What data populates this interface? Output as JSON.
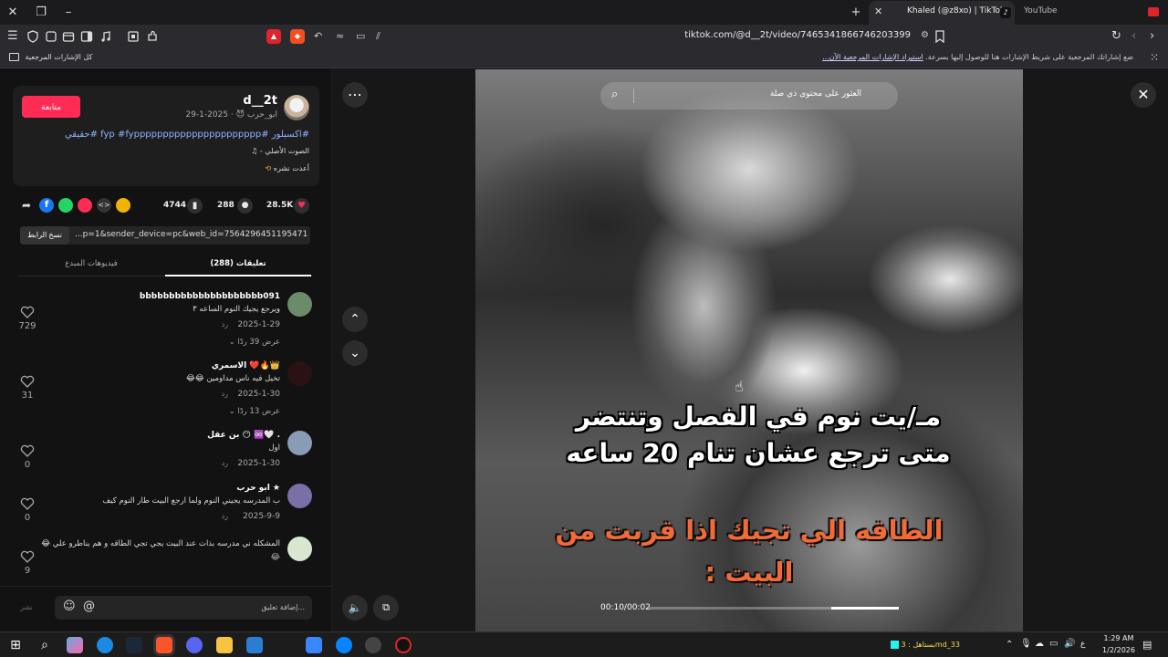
{
  "browser": {
    "active_tab_title": "Khaled (@z8xo) | TikTok",
    "other_tab_title": "YouTube",
    "url": "tiktok.com/@d__2t/video/7465341866746203399",
    "bookmarks_folder": "كل الإشارات المرجعية",
    "bookmarks_hint": "ضع إشاراتك المرجعية على شريط الإشارات هنا للوصول إليها بسرعة.",
    "bookmarks_import": "استيراد الإشارات المرجعية الآن..."
  },
  "post": {
    "follow_label": "متابعة",
    "author_name": "d__2t",
    "author_sub": "ابو_حرب 😈 · 2025-1-29",
    "caption": "#اكسبلور #fyp #fypppppppppppppppppppppp #حقيقي",
    "music": "الصوت الأصلي -",
    "reposted": "أعدت نشره"
  },
  "stats": {
    "likes": "28.5K",
    "comments": "288",
    "saves": "4744"
  },
  "share": {
    "copy_label": "نسخ الرابط",
    "link": "...p=1&sender_device=pc&web_id=7564296451195471380"
  },
  "tabs": {
    "comments": "تعليقات (288)",
    "creator_videos": "فيديوهات المبدع"
  },
  "comments": [
    {
      "name": "bbbbbbbbbbbbbbbbbbbbb091",
      "text": "ويرجع يجيك النوم الساعه ٣",
      "date": "2025-1-29",
      "reply": "رد",
      "likes": "729",
      "more": "عرض 39 ردًا",
      "avatar_color": "#6a8c6a"
    },
    {
      "name": "الاسمري ❤️🔥👑",
      "text": "تخيل فيه ناس مداومين 😂😂",
      "date": "2025-1-30",
      "reply": "رد",
      "likes": "31",
      "more": "عرض 13 ردًا",
      "avatar_color": "#2a1214"
    },
    {
      "name": "بن عقل 😶 ♾️🤍 .",
      "text": "اول",
      "date": "2025-1-30",
      "reply": "رد",
      "likes": "0",
      "more": "",
      "avatar_color": "#8a9bb5"
    },
    {
      "name": "ابو حرب ★",
      "text": "ب المدرسه يجيني النوم ولما ارجع البيت طار النوم كيف",
      "date": "2025-9-9",
      "reply": "رد",
      "likes": "0",
      "more": "",
      "avatar_color": "#7b6fa8"
    },
    {
      "name": "",
      "text": "المشكله ني مدرسه بذات عند البيت يجي تجي الطاقه و هم يناطرو علي 😂",
      "date": "😂",
      "reply": "",
      "likes": "9",
      "more": "",
      "avatar_color": "#d9e6d0"
    }
  ],
  "composer": {
    "placeholder": "إضافة تعليق...",
    "post_label": "نشر"
  },
  "video": {
    "search_placeholder": "العثور على محتوى ذي صلة",
    "line1": "مـ/يت نوم في الفصل وتنتضر",
    "line2": "متى ترجع عشان تنام 20 ساعه",
    "line3": "الطاقه الي تجيك اذا قربت من",
    "line4": "البيت :",
    "time": "00:10/00:02",
    "progress": 0.27
  },
  "taskbar": {
    "user_label": "بستاهل : 3md_33",
    "time": "1:29 AM",
    "date": "1/2/2026"
  },
  "colors": {
    "accent": "#fe2c55",
    "tiktok_cyan": "#25f4ee"
  }
}
